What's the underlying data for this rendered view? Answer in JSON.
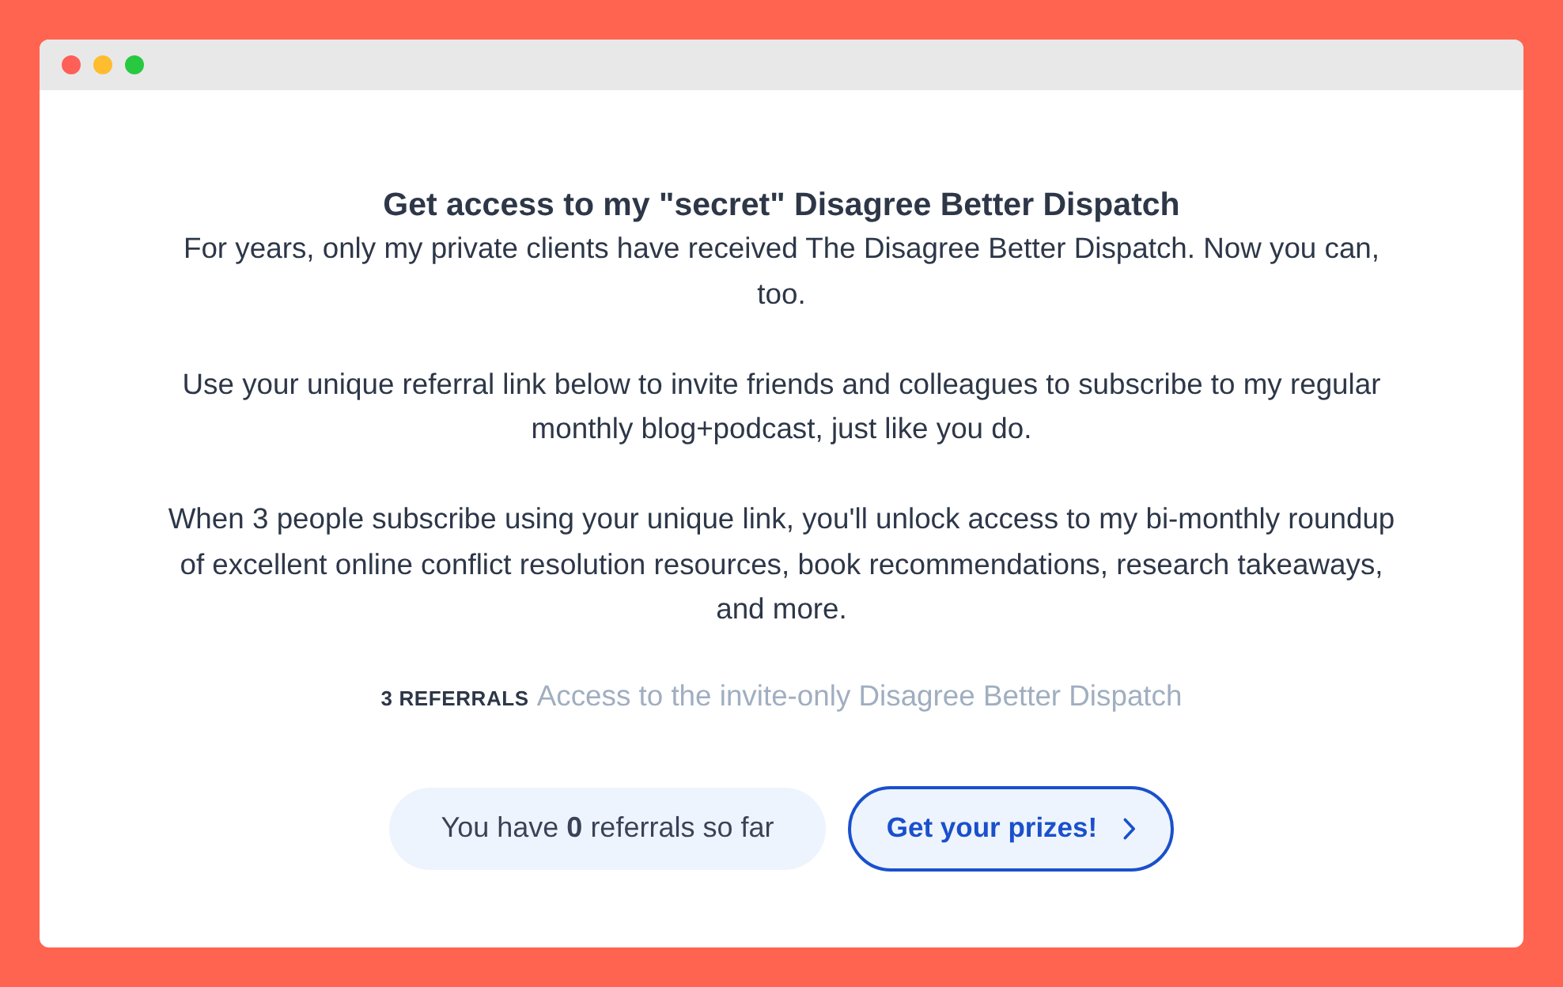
{
  "heading": "Get access to my \"secret\" Disagree Better Dispatch",
  "paragraphs": [
    "For years, only my private clients have received The Disagree Better Dispatch. Now you can, too.",
    "Use your unique referral link below to invite friends and colleagues to subscribe to my regular monthly blog+podcast, just like you do.",
    "When 3 people subscribe using your unique link, you'll unlock access to my bi-monthly roundup of excellent online conflict resolution resources, book recommendations, research takeaways, and more."
  ],
  "reward": {
    "count_label": "3 REFERRALS",
    "description": "Access to the invite-only Disagree Better Dispatch"
  },
  "referral_status": {
    "text": "You have **0** referrals so far"
  },
  "prize_button": {
    "label": "Get your prizes!"
  }
}
